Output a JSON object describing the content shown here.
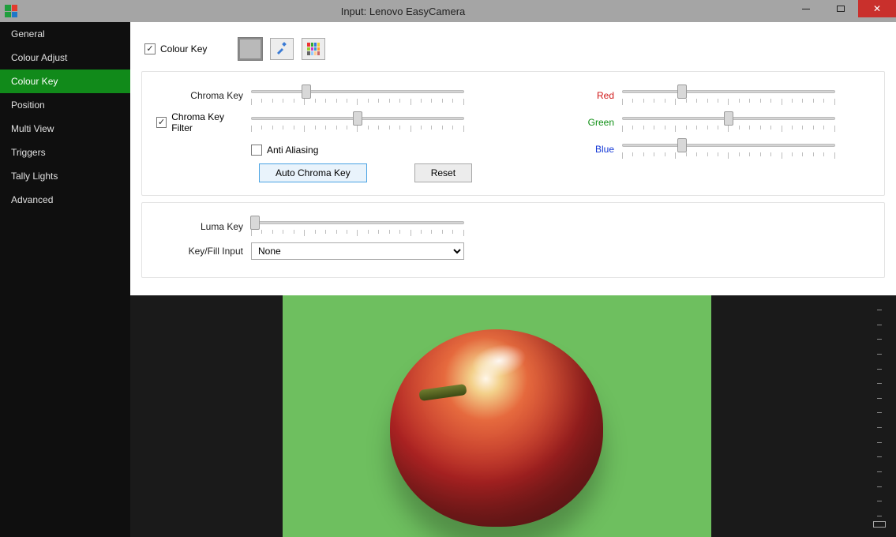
{
  "window": {
    "title": "Input: Lenovo EasyCamera"
  },
  "sidebar": {
    "items": [
      {
        "label": "General"
      },
      {
        "label": "Colour Adjust"
      },
      {
        "label": "Colour Key",
        "active": true
      },
      {
        "label": "Position"
      },
      {
        "label": "Multi View"
      },
      {
        "label": "Triggers"
      },
      {
        "label": "Tally Lights"
      },
      {
        "label": "Advanced"
      }
    ]
  },
  "colourkey": {
    "enable_label": "Colour Key",
    "enable_checked": true,
    "chroma_label": "Chroma Key",
    "chroma_value": 26,
    "filter_label": "Chroma Key Filter",
    "filter_checked": true,
    "filter_value": 50,
    "antialias_label": "Anti Aliasing",
    "antialias_checked": false,
    "auto_btn": "Auto Chroma Key",
    "reset_btn": "Reset",
    "red_label": "Red",
    "red_value": 28,
    "green_label": "Green",
    "green_value": 50,
    "blue_label": "Blue",
    "blue_value": 28
  },
  "luma": {
    "label": "Luma Key",
    "value": 0,
    "keyfill_label": "Key/Fill Input",
    "keyfill_value": "None"
  },
  "volume": {
    "value": 0
  }
}
